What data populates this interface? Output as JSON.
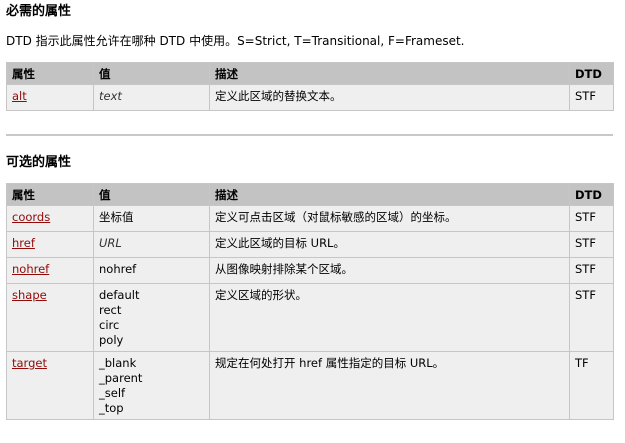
{
  "required": {
    "heading": "必需的属性",
    "intro": "DTD 指示此属性允许在哪种 DTD 中使用。S=Strict, T=Transitional, F=Frameset.",
    "headers": {
      "attr": "属性",
      "value": "值",
      "desc": "描述",
      "dtd": "DTD"
    },
    "rows": [
      {
        "attr": "alt",
        "value": "text",
        "desc": "定义此区域的替换文本。",
        "dtd": "STF"
      }
    ]
  },
  "optional": {
    "heading": "可选的属性",
    "headers": {
      "attr": "属性",
      "value": "值",
      "desc": "描述",
      "dtd": "DTD"
    },
    "rows": [
      {
        "attr": "coords",
        "value": "坐标值",
        "desc": "定义可点击区域（对鼠标敏感的区域）的坐标。",
        "dtd": "STF"
      },
      {
        "attr": "href",
        "value": "URL",
        "desc": "定义此区域的目标 URL。",
        "dtd": "STF"
      },
      {
        "attr": "nohref",
        "value": "nohref",
        "desc": "从图像映射排除某个区域。",
        "dtd": "STF"
      },
      {
        "attr": "shape",
        "values": [
          "default",
          "rect",
          "circ",
          "poly"
        ],
        "desc": "定义区域的形状。",
        "dtd": "STF"
      },
      {
        "attr": "target",
        "values": [
          "_blank",
          "_parent",
          "_self",
          "_top"
        ],
        "desc": "规定在何处打开 href 属性指定的目标 URL。",
        "dtd": "TF"
      }
    ]
  },
  "colors": {
    "header_bg": "#c3c3c3",
    "cell_bg": "#efefef",
    "link": "#900b09",
    "rule": "#c8c8c8"
  }
}
